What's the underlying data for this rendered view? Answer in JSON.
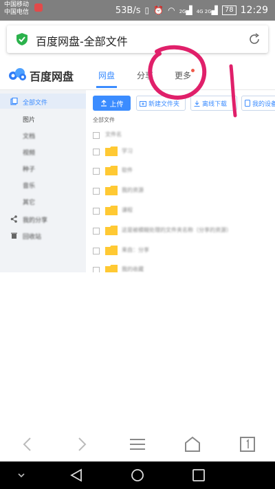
{
  "status_bar": {
    "carrier1": "中国移动",
    "carrier2": "中国电信",
    "speed": "53B/s",
    "network1": "2G",
    "network2": "4G 2G",
    "battery": "78",
    "time": "12:29"
  },
  "browser": {
    "page_title": "百度网盘-全部文件"
  },
  "header": {
    "logo_text": "百度网盘",
    "tabs": [
      {
        "label": "网盘"
      },
      {
        "label": "分享"
      },
      {
        "label": "更多"
      }
    ]
  },
  "sidebar": {
    "items": [
      {
        "label": "全部文件"
      },
      {
        "label": "图片"
      },
      {
        "label": "文档"
      },
      {
        "label": "视频"
      },
      {
        "label": "种子"
      },
      {
        "label": "音乐"
      },
      {
        "label": "其它"
      },
      {
        "label": "我的分享"
      },
      {
        "label": "回收站"
      }
    ]
  },
  "toolbar": {
    "upload_label": "上传",
    "new_folder_label": "新建文件夹",
    "offline_download_label": "离线下载",
    "my_device_label": "我的设备"
  },
  "breadcrumb": "全部文件",
  "file_list": {
    "header": "文件名",
    "rows": [
      {
        "name": "学习"
      },
      {
        "name": "软件"
      },
      {
        "name": "我的资源"
      },
      {
        "name": "课程"
      },
      {
        "name": "这是被模糊处理的文件夹名称（分享的资源）"
      },
      {
        "name": "来自：分享"
      },
      {
        "name": "我的收藏"
      }
    ]
  },
  "colors": {
    "accent": "#3b8cff",
    "folder": "#ffc933",
    "annotation": "#e0206a"
  }
}
